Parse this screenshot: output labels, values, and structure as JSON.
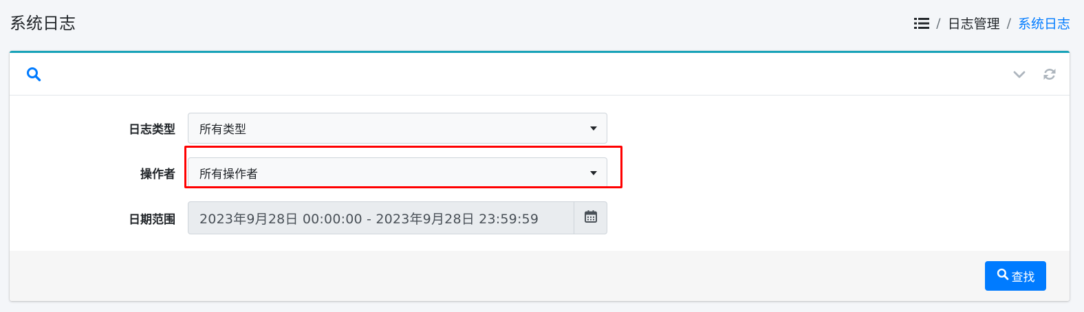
{
  "page": {
    "title": "系统日志"
  },
  "breadcrumb": {
    "items": [
      "日志管理",
      "系统日志"
    ],
    "separator": "/",
    "icon": "list-icon",
    "active_color": "#007bff"
  },
  "card": {
    "accent_color": "#17a2b8",
    "header_icon": "search-icon",
    "tools": [
      "chevron-down-icon",
      "refresh-icon"
    ]
  },
  "form": {
    "log_type": {
      "label": "日志类型",
      "value": "所有类型"
    },
    "operator": {
      "label": "操作者",
      "value": "所有操作者"
    },
    "date_range": {
      "label": "日期范围",
      "value": "2023年9月28日 00:00:00 - 2023年9月28日 23:59:59",
      "icon": "calendar-icon"
    }
  },
  "footer": {
    "search_button": {
      "label": "查找",
      "color": "#007bff",
      "icon": "search-icon"
    }
  },
  "highlight_color": "#ff0000"
}
